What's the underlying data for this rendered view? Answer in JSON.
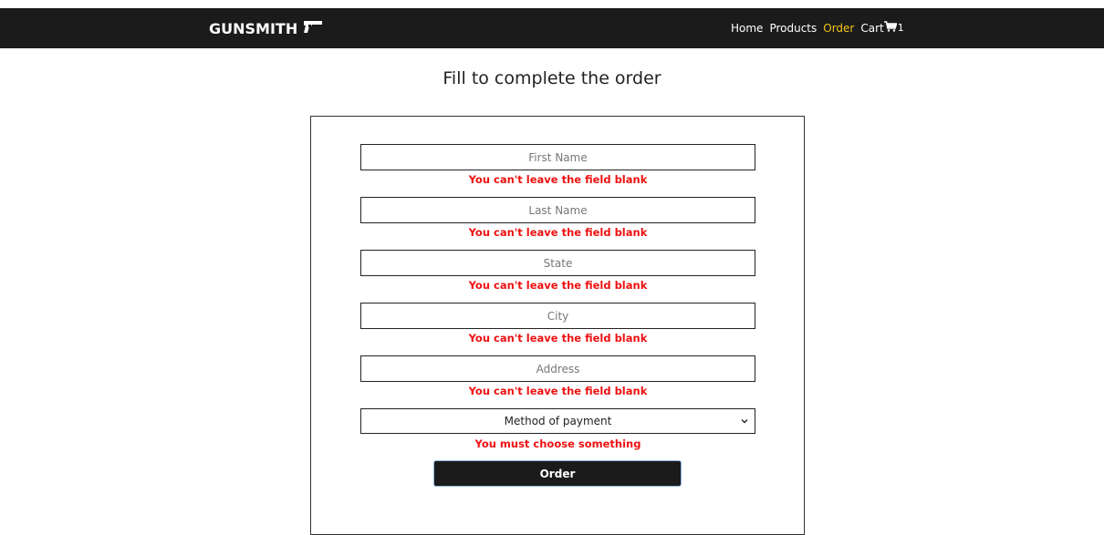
{
  "navbar": {
    "brand": "GUNSMITH",
    "brand_icon": "pistol-icon",
    "links": [
      {
        "label": "Home",
        "active": false
      },
      {
        "label": "Products",
        "active": false
      },
      {
        "label": "Order",
        "active": true
      }
    ],
    "cart": {
      "label": "Cart",
      "icon": "shopping-cart-icon",
      "count": "1"
    },
    "active_color": "#f5c518",
    "background": "#1b1b1b"
  },
  "page": {
    "title": "Fill to complete the order"
  },
  "form": {
    "fields": [
      {
        "placeholder": "First Name",
        "value": "",
        "error": "You can't leave the field blank"
      },
      {
        "placeholder": "Last Name",
        "value": "",
        "error": "You can't leave the field blank"
      },
      {
        "placeholder": "State",
        "value": "",
        "error": "You can't leave the field blank"
      },
      {
        "placeholder": "City",
        "value": "",
        "error": "You can't leave the field blank"
      },
      {
        "placeholder": "Address",
        "value": "",
        "error": "You can't leave the field blank"
      }
    ],
    "payment": {
      "selected": "Method of payment",
      "error": "You must choose something"
    },
    "submit_label": "Order",
    "error_color": "#ee1111"
  }
}
